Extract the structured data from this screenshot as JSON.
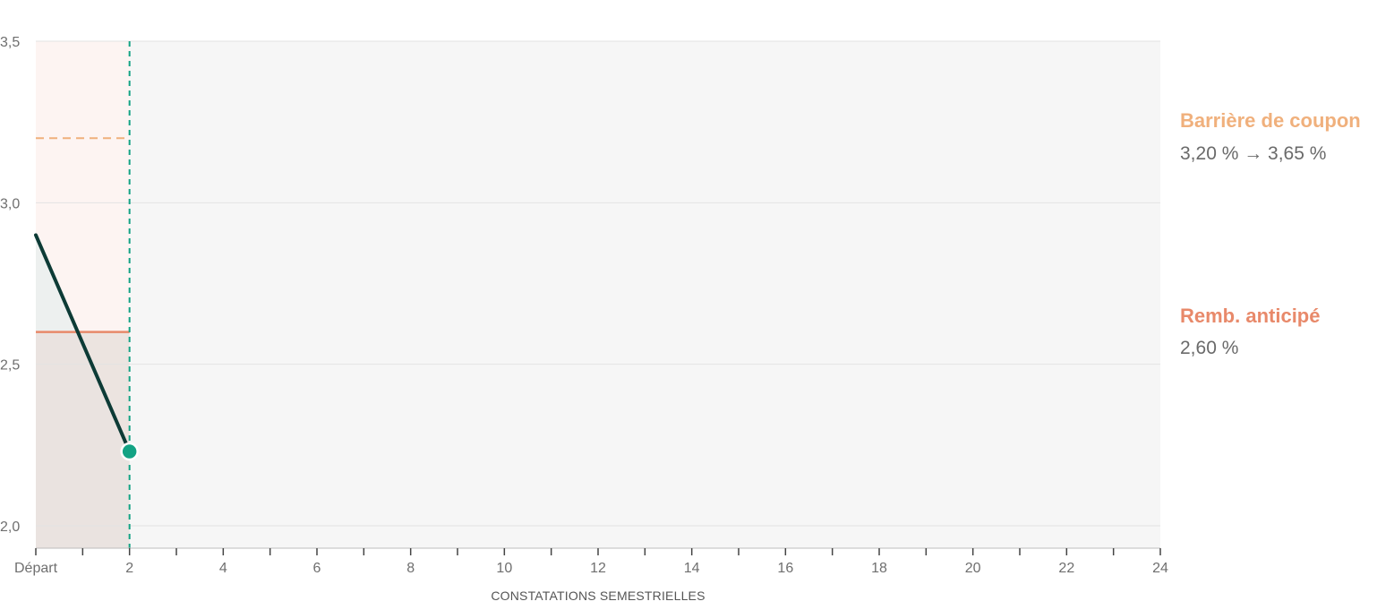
{
  "chart_data": {
    "type": "line",
    "title": "",
    "xlabel": "CONSTATATIONS SEMESTRIELLES",
    "ylabel": "",
    "xlim": [
      0,
      24
    ],
    "ylim": [
      2.0,
      3.5
    ],
    "x_ticks": [
      {
        "value": 0,
        "label": "Départ"
      },
      {
        "value": 2,
        "label": "2"
      },
      {
        "value": 4,
        "label": "4"
      },
      {
        "value": 6,
        "label": "6"
      },
      {
        "value": 8,
        "label": "8"
      },
      {
        "value": 10,
        "label": "10"
      },
      {
        "value": 12,
        "label": "12"
      },
      {
        "value": 14,
        "label": "14"
      },
      {
        "value": 16,
        "label": "16"
      },
      {
        "value": 18,
        "label": "18"
      },
      {
        "value": 20,
        "label": "20"
      },
      {
        "value": 22,
        "label": "22"
      },
      {
        "value": 24,
        "label": "24"
      }
    ],
    "y_ticks": [
      {
        "value": 2.0,
        "label": "2,0"
      },
      {
        "value": 2.5,
        "label": "2,5"
      },
      {
        "value": 3.0,
        "label": "3,0"
      },
      {
        "value": 3.5,
        "label": "3,5"
      }
    ],
    "minor_tick_step": 1,
    "grid": true,
    "series": [
      {
        "points": [
          {
            "x": 0,
            "y": 2.9
          },
          {
            "x": 2,
            "y": 2.23
          }
        ],
        "color": "#0d3b36"
      }
    ],
    "current_point": {
      "x": 2,
      "y": 2.23,
      "color": "#13a384"
    },
    "current_marker_x": 2,
    "coupon_barrier": {
      "value": 3.2,
      "color": "#f0b07c"
    },
    "autocall_barrier": {
      "value": 2.6,
      "color": "#e8896a"
    }
  },
  "annotations": {
    "coupon": {
      "title": "Barrière de coupon",
      "value": "3,20 % → 3,65 %",
      "color": "#f0b07c"
    },
    "autocall": {
      "title": "Remb. anticipé",
      "value": "2,60 %",
      "color": "#e8896a"
    }
  }
}
